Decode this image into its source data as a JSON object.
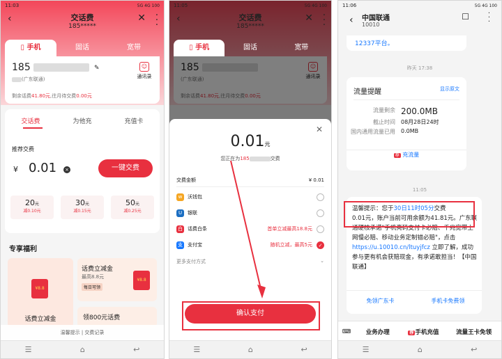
{
  "phone1": {
    "status_time": "11:03",
    "status_right": "5G 4G 100",
    "title": "交话费",
    "subtitle": "185*****",
    "tabs": [
      "手机",
      "固话",
      "宽带"
    ],
    "phone_number": "185",
    "carrier": "(广东联通)",
    "contacts_label": "通讯录",
    "balance_prefix": "剩余话费",
    "balance_value": "41.80元",
    "pending_prefix": ",往月待交费",
    "pending_value": "0.00元",
    "subtabs": [
      "交话费",
      "为他充",
      "充值卡"
    ],
    "recommend_label": "推荐交费",
    "currency": "¥",
    "amount": "0.01",
    "pay_button": "一键交费",
    "options": [
      {
        "amount": "20",
        "unit": "元",
        "discount": "减0.10元"
      },
      {
        "amount": "30",
        "unit": "元",
        "discount": "减0.15元"
      },
      {
        "amount": "50",
        "unit": "元",
        "discount": "减0.25元"
      }
    ],
    "welfare_title": "专享福利",
    "welfare1": "话费立减金",
    "welfare2_title": "话费立减金",
    "welfare2_max": "最高8.8元",
    "welfare2_tag": "每日可领",
    "welfare3": "领800元话费",
    "envelope_text": "¥8.8",
    "footer_links": "温馨提示 | 交费记录"
  },
  "phone2": {
    "status_time": "11:05",
    "title": "交话费",
    "subtitle": "185*****",
    "tabs": [
      "手机",
      "固话",
      "宽带"
    ],
    "phone_number": "185",
    "carrier": "(广东联通)",
    "contacts_label": "通讯录",
    "balance_prefix": "剩余话费",
    "balance_value": "41.80元",
    "pending_prefix": ",往月待交费",
    "pending_value": "0.00元",
    "sheet_amount": "0.01",
    "sheet_unit": "元",
    "sheet_desc_prefix": "您正在为",
    "sheet_desc_number": "185",
    "sheet_desc_suffix": "交费",
    "amount_label": "交费金额",
    "amount_value": "¥ 0.01",
    "methods": [
      {
        "name": "沃钱包",
        "promo": "",
        "icon": "wo",
        "color": "#f5a623",
        "selected": false
      },
      {
        "name": "银联",
        "promo": "",
        "icon": "U",
        "color": "#1b6ec2",
        "selected": false
      },
      {
        "name": "话费白条",
        "promo": "首单立减最高18.8元",
        "icon": "白",
        "color": "#e8303f",
        "selected": false
      },
      {
        "name": "支付宝",
        "promo": "随机立减，最高5元",
        "icon": "支",
        "color": "#1677ff",
        "selected": true
      }
    ],
    "more_methods": "更多支付方式",
    "confirm_button": "确认支付"
  },
  "phone3": {
    "status_time": "11:06",
    "contact_name": "中国联通",
    "contact_number": "10010",
    "prev_msg_tail": "12337平台。",
    "time1": "昨天 17:38",
    "card_title": "流量提醒",
    "card_link": "显示原文",
    "rows": [
      {
        "k": "流量剩余",
        "v": "200.0MB"
      },
      {
        "k": "截止时间",
        "v": "08月28日24时"
      },
      {
        "k": "国内通用流量已用",
        "v": "0.0MB"
      }
    ],
    "card_action": "充流量",
    "time2": "11:05",
    "msg_l1a": "温馨提示：您于",
    "msg_l1b": "30日11时05分",
    "msg_l1c": "交费",
    "msg_l2": "0.01元，账户当前可用余额为41.81",
    "msg_rest": "元。广东联通硬核承诺\"手机亮码支付卡必赔、千兆宽带上网慢必赔、移动业务定制错必赔\"，点击",
    "msg_link": "https://u.10010.cn/ltuyjfcz",
    "msg_end": " 立即了解，成功参与更有机会获赔现金，有承诺敢担当！【中国联通】",
    "actions": [
      "免领广东卡",
      "手机卡免费领"
    ],
    "bottom": [
      "业务办理",
      "手机充值",
      "流量王卡免领"
    ]
  }
}
